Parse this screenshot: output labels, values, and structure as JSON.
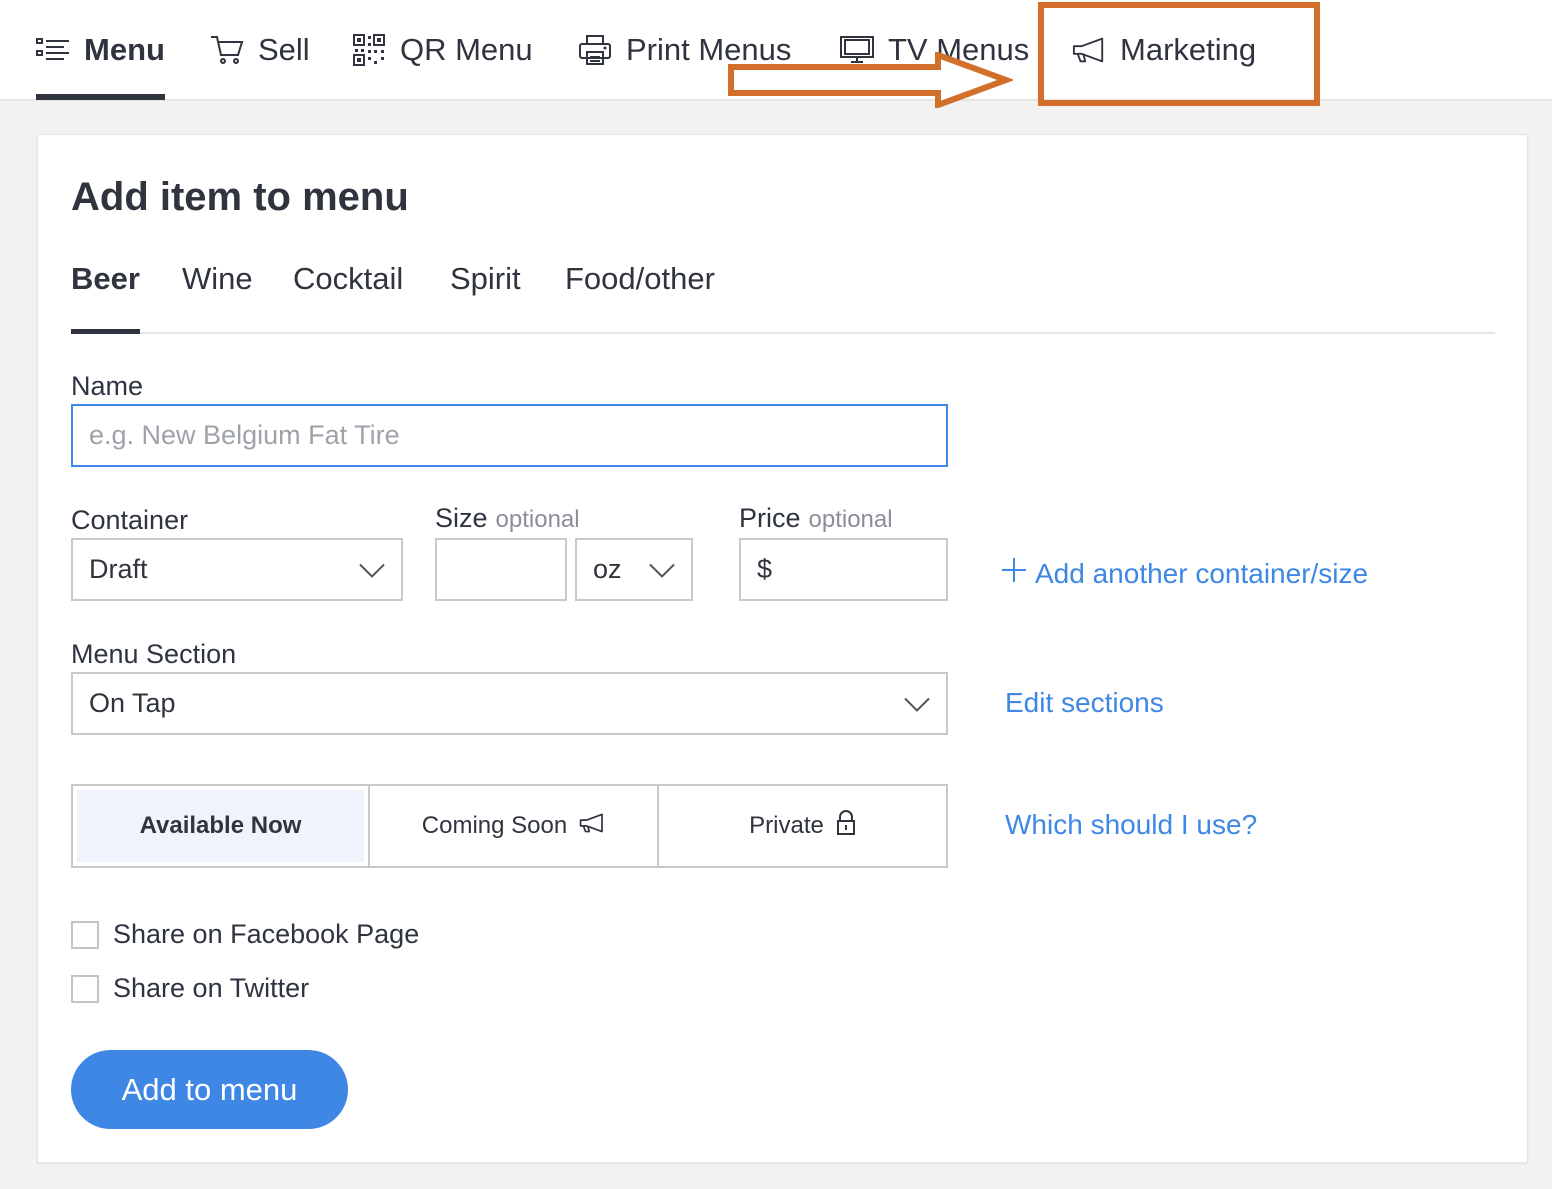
{
  "nav": {
    "items": [
      {
        "label": "Menu",
        "icon": "list-icon",
        "active": true
      },
      {
        "label": "Sell",
        "icon": "cart-icon"
      },
      {
        "label": "QR Menu",
        "icon": "qr-code-icon"
      },
      {
        "label": "Print Menus",
        "icon": "printer-icon"
      },
      {
        "label": "TV Menus",
        "icon": "monitor-icon"
      },
      {
        "label": "Marketing",
        "icon": "megaphone-icon"
      }
    ],
    "highlight_color": "#d26f2a"
  },
  "form": {
    "title": "Add item to menu",
    "tabs": [
      "Beer",
      "Wine",
      "Cocktail",
      "Spirit",
      "Food/other"
    ],
    "active_tab": "Beer",
    "name": {
      "label": "Name",
      "placeholder": "e.g. New Belgium Fat Tire",
      "value": ""
    },
    "container": {
      "label": "Container",
      "value": "Draft"
    },
    "size": {
      "label": "Size",
      "optional": "optional",
      "value": "",
      "unit": "oz"
    },
    "price": {
      "label": "Price",
      "optional": "optional",
      "currency": "$",
      "value": ""
    },
    "add_container_link": "Add another container/size",
    "menu_section": {
      "label": "Menu Section",
      "value": "On Tap"
    },
    "edit_sections_link": "Edit sections",
    "availability": {
      "options": [
        "Available Now",
        "Coming Soon",
        "Private"
      ],
      "selected": "Available Now"
    },
    "which_link": "Which should I use?",
    "share_facebook": "Share on Facebook Page",
    "share_twitter": "Share on Twitter",
    "submit_label": "Add to menu"
  },
  "colors": {
    "accent": "#3f87e5",
    "text": "#30343f",
    "annotation": "#d26f2a"
  }
}
